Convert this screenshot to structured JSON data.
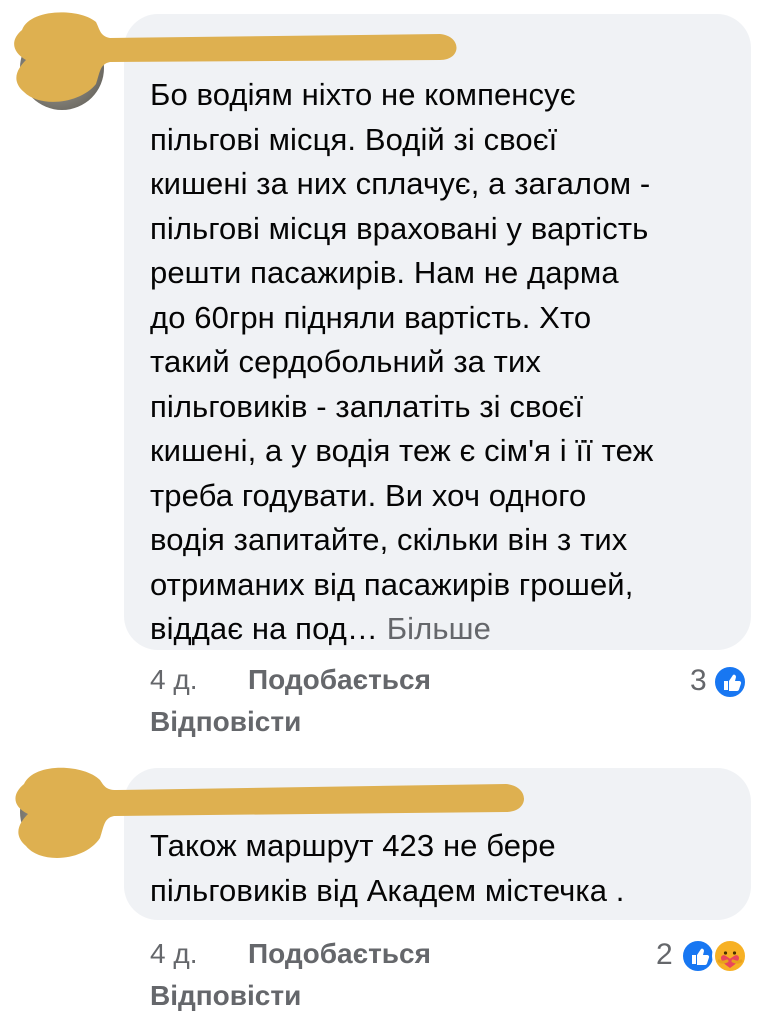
{
  "comments": [
    {
      "text": "Бо водіям ніхто не компенсує\nпільгові місця. Водій зі своєї\nкишені за них сплачує, а загалом -\nпільгові місця враховані у вартість\nрешти пасажирів. Нам не дарма\nдо 60грн підняли вартість. Хто\nтакий сердобольний за тих\nпільговиків - заплатіть зі своєї\nкишені, а у водія теж є сім'я і її теж\nтреба годувати. Ви хоч одного\nводія запитайте, скільки він з тих\nотриманих від пасажирів грошей,\nвіддає на под…",
      "see_more": "Більше",
      "time": "4 д.",
      "like_label": "Подобається",
      "reply_label": "Відповісти",
      "reaction_count": "3",
      "reactions": [
        "like-icon"
      ]
    },
    {
      "text": "Також маршрут 423 не бере\nпільговиків від Академ містечка .",
      "time": "4 д.",
      "like_label": "Подобається",
      "reply_label": "Відповісти",
      "reaction_count": "2",
      "reactions": [
        "like-icon",
        "care-icon"
      ]
    }
  ],
  "colors": {
    "bubble": "#f0f2f5",
    "secondary_text": "#65676b",
    "like_blue": "#1877f2",
    "care_yellow": "#f7b125",
    "redaction": "#deb050"
  }
}
